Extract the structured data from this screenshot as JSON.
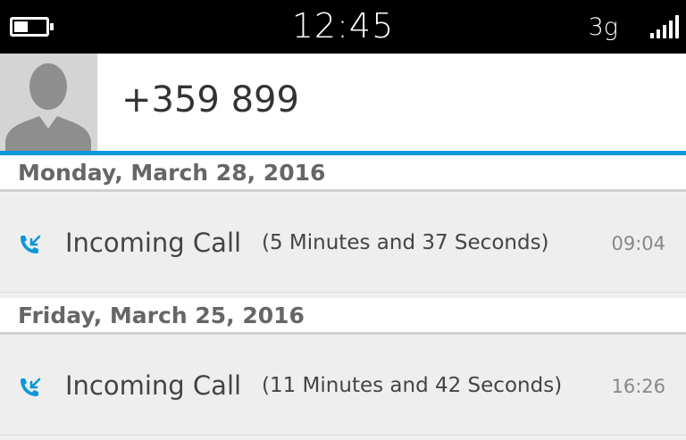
{
  "status_bar": {
    "time": "12:45",
    "network": "3g",
    "battery_level": 0.45,
    "signal_bars": 5
  },
  "contact": {
    "number": "+359 899"
  },
  "accent_color": "#0b97d9",
  "call_groups": [
    {
      "date": "Monday, March 28, 2016",
      "call": {
        "icon": "incoming-call-icon",
        "type": "Incoming Call",
        "duration": "(5 Minutes and 37 Seconds)",
        "time": "09:04"
      }
    },
    {
      "date": "Friday, March 25, 2016",
      "call": {
        "icon": "incoming-call-icon",
        "type": "Incoming Call",
        "duration": "(11 Minutes and 42 Seconds)",
        "time": "16:26"
      }
    }
  ]
}
